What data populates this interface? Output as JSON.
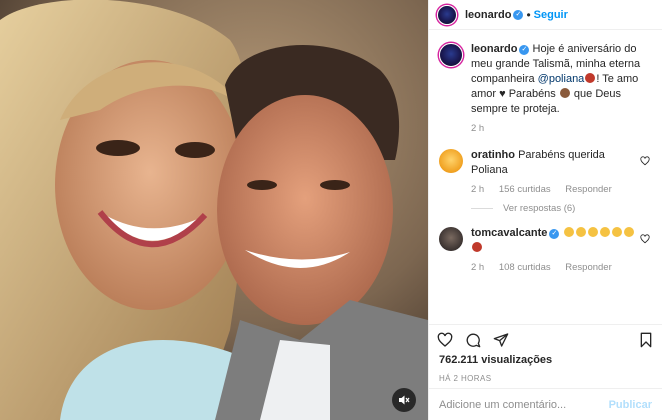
{
  "post": {
    "author": "leonardo",
    "follow_label": "Seguir",
    "separator": "•"
  },
  "caption": {
    "username": "leonardo",
    "text_part1": "Hoje é aniversário do meu grande Talismã, minha eterna companheira ",
    "mention": "@poliana",
    "text_part2": "! Te amo amor",
    "text_part3": " Parabéns ",
    "text_part4": " que Deus sempre te proteja.",
    "time": "2 h"
  },
  "comments": [
    {
      "username": "oratinho",
      "text": "Parabéns querida Poliana",
      "time": "2 h",
      "likes": "156 curtidas",
      "reply_label": "Responder",
      "replies_label": "Ver respostas (6)"
    },
    {
      "username": "tomcavalcante",
      "text": "",
      "time": "2 h",
      "likes": "108 curtidas",
      "reply_label": "Responder"
    }
  ],
  "stats": {
    "views": "762.211 visualizações",
    "posted": "HÁ 2 HORAS"
  },
  "comment_box": {
    "placeholder": "Adicione um comentário...",
    "publish_label": "Publicar"
  },
  "colors": {
    "accent": "#0095f6",
    "verified": "#3897f0",
    "muted": "#8e8e8e"
  },
  "icons": [
    "verified-icon",
    "heart-icon",
    "comment-icon",
    "share-icon",
    "bookmark-icon",
    "mute-icon"
  ]
}
